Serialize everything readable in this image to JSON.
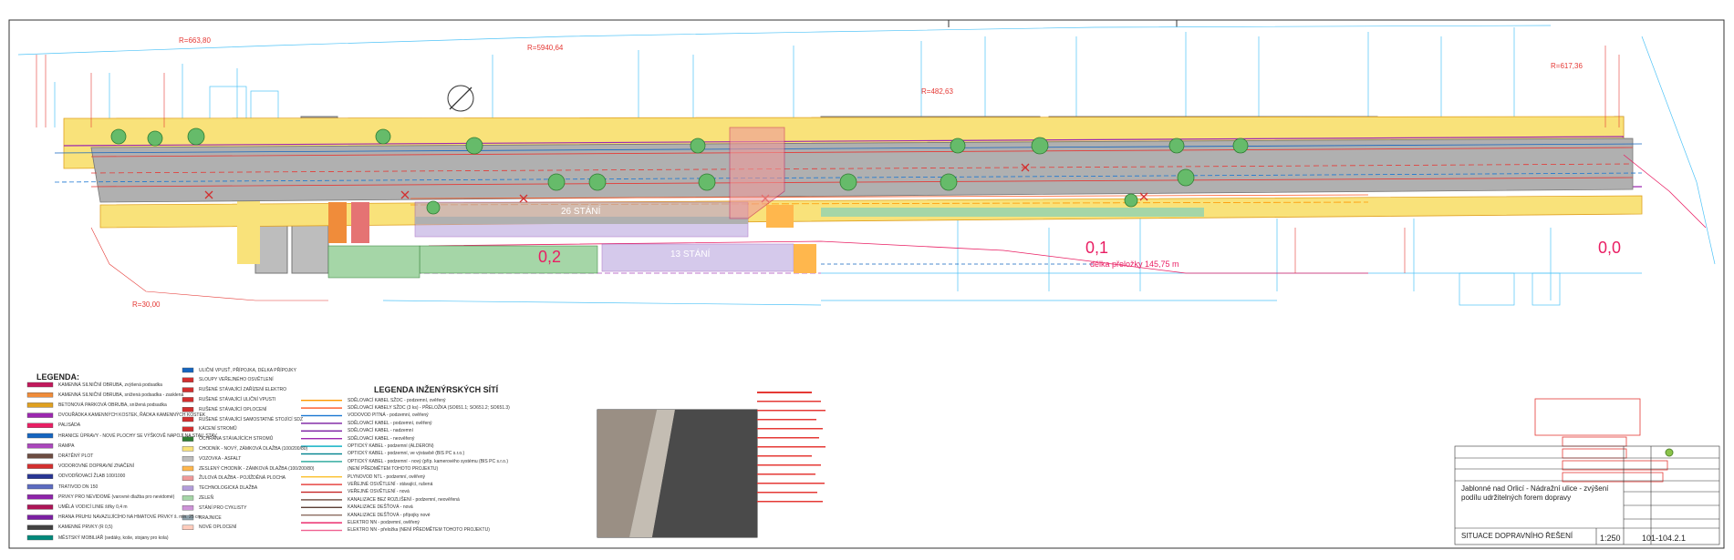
{
  "plan": {
    "stall_labels": [
      "26 STÁNÍ",
      "13 STÁNÍ"
    ],
    "chainage_labels": [
      "0,2",
      "0,1",
      "0,0"
    ],
    "length_label": "délka přeložky 145,75 m",
    "radii": [
      "R=5940,64",
      "R=663,80",
      "R=482,63",
      "R=617,36",
      "R=30,00"
    ]
  },
  "legend_left": {
    "title": "LEGENDA:",
    "items": [
      {
        "label": "KAMENNÁ SILNIČNÍ OBRUBA, zvýšená podsadka",
        "color": "#c2185b"
      },
      {
        "label": "KAMENNÁ SILNIČNÍ OBRUBA, snížená podsadka - zasklená",
        "color": "#f08c3a"
      },
      {
        "label": "BETONOVÁ PARKOVÁ OBRUBA, snížená podsadka",
        "color": "#e0a020"
      },
      {
        "label": "DVOUŘÁDKA KAMENNÝCH KOSTEK, ŘÁDKA KAMENNÝCH KOSTEK",
        "color": "#9c27b0"
      },
      {
        "label": "PALISÁDA",
        "color": "#e91e63"
      },
      {
        "label": "HRANICE ÚPRAVY - NOVÉ PLOCHY SE VÝŠKOVĚ NAPOJÍ NA STAV. STAV.",
        "color": "#1565c0"
      },
      {
        "label": "RAMPA",
        "color": "#ab47bc"
      },
      {
        "label": "DRÁTĚNÝ PLOT",
        "color": "#6d4c41"
      },
      {
        "label": "VODOROVNÉ DOPRAVNÍ ZNAČENÍ",
        "color": "#d32f2f"
      },
      {
        "label": "ODVODŇOVACÍ ŽLAB 100/1000",
        "color": "#283593"
      },
      {
        "label": "TRATIVOD DN 150",
        "color": "#5c6bc0"
      },
      {
        "label": "PRVKY PRO NEVIDOMÉ (varovné dlažba pro nevidomé)",
        "color": "#8e24aa"
      },
      {
        "label": "UMĚLÁ VODICÍ LINIE šířky 0,4 m",
        "color": "#ad1457"
      },
      {
        "label": "HRANA PRUHU NAVAZUJÍCÍHO NA HMATOVÉ PRVKY š. min. 25 cm",
        "color": "#7b1fa2"
      },
      {
        "label": "KAMENNÉ PRVKY (R 0,5)",
        "color": "#424242"
      },
      {
        "label": "MĚSTSKÝ MOBILIÁŘ (sedáky, koše, stojany pro kola)",
        "color": "#00897b"
      }
    ]
  },
  "legend_mid": {
    "items": [
      {
        "label": "ULIČNÍ VPUSŤ, PŘÍPOJKA, DÉLKA PŘÍPOJKY",
        "color": "#1565c0"
      },
      {
        "label": "SLOUPY VEŘEJNÉHO OSVĚTLENÍ",
        "color": "#d32f2f"
      },
      {
        "label": "RUŠENÉ STÁVAJÍCÍ ZAŘÍZENÍ ELEKTRO",
        "color": "#d32f2f"
      },
      {
        "label": "RUŠENÉ STÁVAJÍCÍ ULIČNÍ VPUSTI",
        "color": "#d32f2f"
      },
      {
        "label": "RUŠENÉ STÁVAJÍCÍ OPLOCENÍ",
        "color": "#d32f2f"
      },
      {
        "label": "RUŠENÉ STÁVAJÍCÍ SAMOSTATNÉ STOJÍCÍ SDZ",
        "color": "#d32f2f"
      },
      {
        "label": "KÁCENÍ STROMŮ",
        "color": "#d32f2f"
      },
      {
        "label": "OCHRANA STÁVAJÍCÍCH STROMŮ",
        "color": "#2e7d32"
      },
      {
        "label": "CHODNÍK - NOVÝ, ZÁMKOVÁ DLAŽBA (100/200/80)",
        "color": "#f9e27a"
      },
      {
        "label": "VOZOVKA - ASFALT",
        "color": "#bdbdbd"
      },
      {
        "label": "ZESLENÝ CHODNÍK - ZÁMKOVÁ DLAŽBA (100/200/80)",
        "color": "#ffb74d"
      },
      {
        "label": "ŽULOVÁ DLAŽBA - POJÍŽDĚNÁ PLOCHA",
        "color": "#ef9a9a"
      },
      {
        "label": "TECHNOLOGICKÁ DLAŽBA",
        "color": "#b39ddb"
      },
      {
        "label": "ZELEŇ",
        "color": "#a5d6a7"
      },
      {
        "label": "STÁNÍ PRO CYKLISTY",
        "color": "#ce93d8"
      },
      {
        "label": "KRAJNICE",
        "color": "#90a4ae"
      },
      {
        "label": "NOVÉ OPLOCENÍ",
        "color": "#ffccbc"
      }
    ]
  },
  "legend_networks": {
    "title": "LEGENDA INŽENÝRSKÝCH SÍTÍ",
    "items": [
      {
        "label": "SDĚLOVACÍ KABEL SŽDC - podzemní, ověřený",
        "color": "#ff9800"
      },
      {
        "label": "SDĚLOVACÍ KABELY SŽDC (3 ks) - PŘELOŽKA (SO651.1; SO651.2; SO651.3)",
        "color": "#ff5722"
      },
      {
        "label": "VODOVOD PITNÁ - podzemní, ověřený",
        "color": "#1976d2"
      },
      {
        "label": "SDĚLOVACÍ KABEL - podzemní, ověřený",
        "color": "#7b1fa2"
      },
      {
        "label": "SDĚLOVACÍ KABEL - nadzemní",
        "color": "#7b1fa2"
      },
      {
        "label": "SDĚLOVACÍ KABEL - neověřený",
        "color": "#9c27b0"
      },
      {
        "label": "OPTICKÝ KABEL - podzemní (ALDERON)",
        "color": "#00acc1"
      },
      {
        "label": "OPTICKÝ KABEL - podzemní, ve výstavbě (BIS PC s.r.o.)",
        "color": "#00838f"
      },
      {
        "label": "OPTICKÝ KABEL - podzemní - nový (příp. kamerového systému (BIS PC s.r.o.)",
        "color": "#26a69a"
      },
      {
        "label": "(NENÍ PŘEDMĚTEM TOHOTO PROJEKTU)",
        "color": "#ffffff"
      },
      {
        "label": "PLYNOVOD NTL - podzemní, ověřený",
        "color": "#fbc02d"
      },
      {
        "label": "VEŘEJNÉ OSVĚTLENÍ - stávající, rušená",
        "color": "#e53935"
      },
      {
        "label": "VEŘEJNÉ OSVĚTLENÍ - nová",
        "color": "#c62828"
      },
      {
        "label": "KANALIZACE BEZ ROZLIŠENÍ - podzemní, neověřená",
        "color": "#6d4c41"
      },
      {
        "label": "KANALIZACE DEŠŤOVÁ - nová",
        "color": "#5d4037"
      },
      {
        "label": "KANALIZACE DEŠŤOVÁ - přípojky nové",
        "color": "#8d6e63"
      },
      {
        "label": "ELEKTRO NN - podzemní, ověřený",
        "color": "#e91e63"
      },
      {
        "label": "ELEKTRO NN - přeložka (NENÍ PŘEDMĚTEM TOHOTO PROJEKTU)",
        "color": "#f06292"
      }
    ]
  },
  "title_block": {
    "project": "Jablonné nad Orlicí - Nádražní ulice - zvýšení podílu udržitelných forem dopravy",
    "drawing_title": "SITUACE DOPRAVNÍHO ŘEŠENÍ",
    "scale": "1:250",
    "drawing_number": "101-104.2.1"
  }
}
